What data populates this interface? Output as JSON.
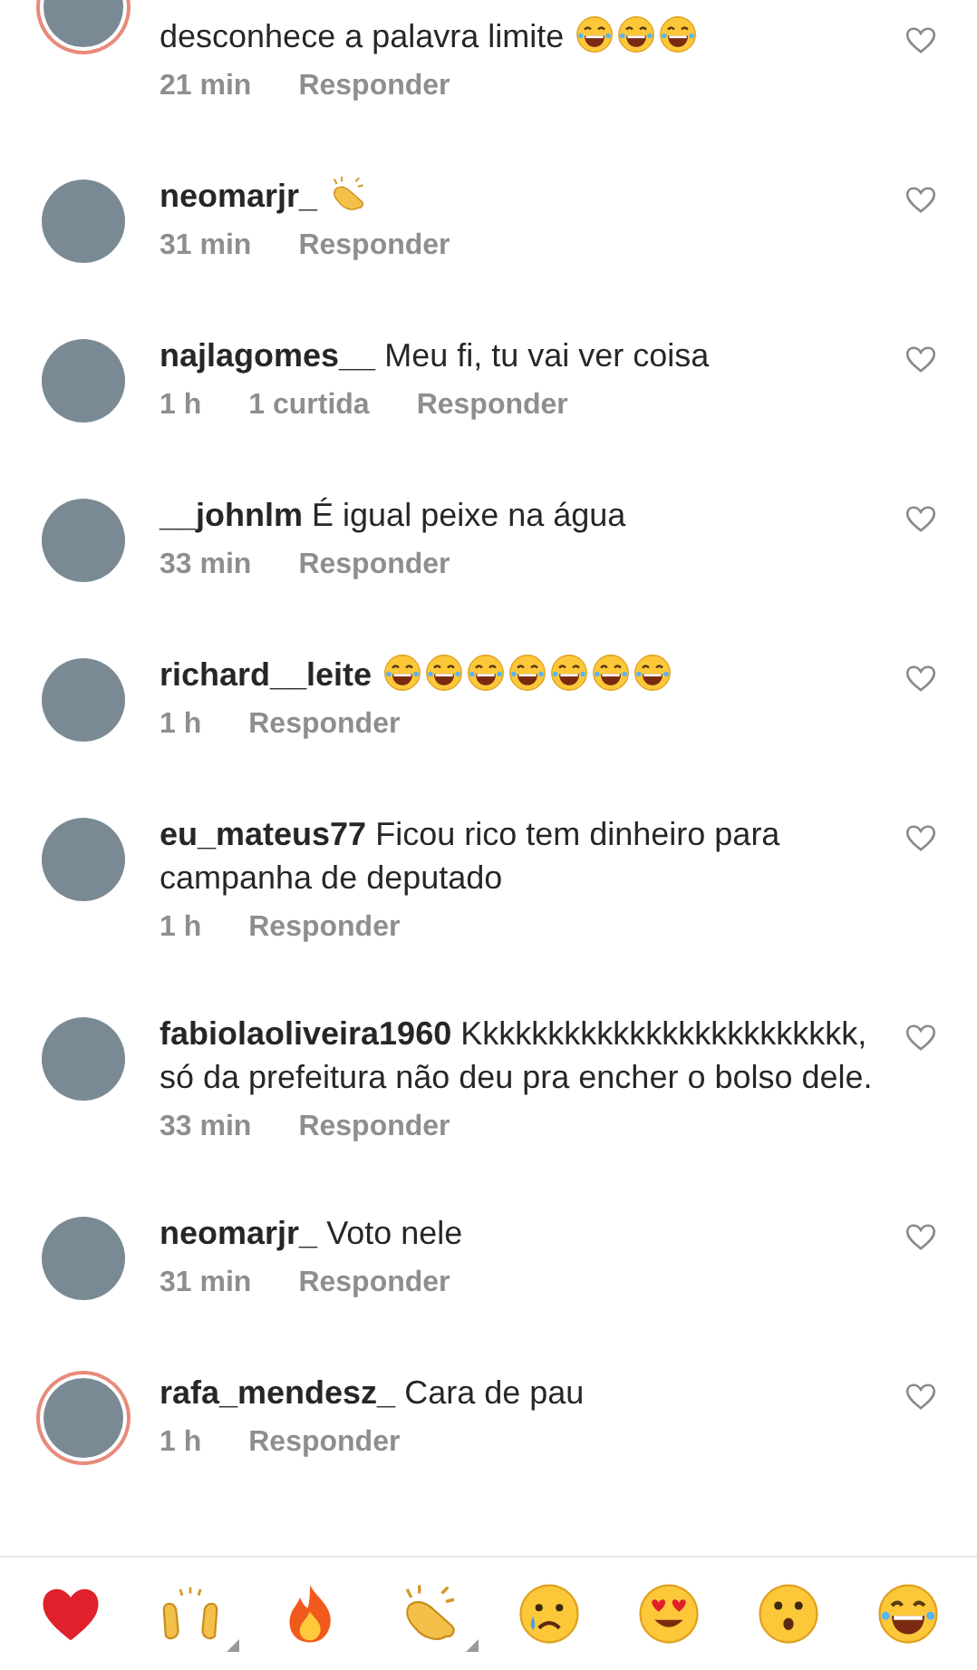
{
  "comments": [
    {
      "text": "desconhece a palavra limite",
      "emojis": [
        {
          "kind": "laughing"
        },
        {
          "kind": "laughing"
        },
        {
          "kind": "laughing"
        }
      ],
      "time": "21 min",
      "reply": "Responder",
      "story": true
    },
    {
      "username": "neomarjr_",
      "emojis": [
        {
          "kind": "clapping"
        }
      ],
      "time": "31 min",
      "reply": "Responder",
      "story": false
    },
    {
      "username": "najlagomes__",
      "text": "Meu fi, tu vai ver coisa",
      "time": "1 h",
      "likes": "1 curtida",
      "reply": "Responder",
      "story": false
    },
    {
      "username": "__johnlm",
      "text": "É igual peixe na água",
      "time": "33 min",
      "reply": "Responder",
      "story": false
    },
    {
      "username": "richard__leite",
      "emojis": [
        {
          "kind": "laughing"
        },
        {
          "kind": "laughing"
        },
        {
          "kind": "laughing"
        },
        {
          "kind": "laughing"
        },
        {
          "kind": "laughing"
        },
        {
          "kind": "laughing"
        },
        {
          "kind": "laughing"
        }
      ],
      "time": "1 h",
      "reply": "Responder",
      "story": false
    },
    {
      "username": "eu_mateus77",
      "text": "Ficou rico tem dinheiro para campanha de deputado",
      "time": "1 h",
      "reply": "Responder",
      "story": false
    },
    {
      "username": "fabiolaoliveira1960",
      "text": "Kkkkkkkkkkkkkkkkkkkkkkkk, só da prefeitura não deu pra encher o bolso dele.",
      "time": "33 min",
      "reply": "Responder",
      "story": false
    },
    {
      "username": "neomarjr_",
      "text": "Voto nele",
      "time": "31 min",
      "reply": "Responder",
      "story": false
    },
    {
      "username": "rafa_mendesz_",
      "text": "Cara de pau",
      "time": "1 h",
      "reply": "Responder",
      "story": true
    }
  ],
  "reactions": [
    {
      "kind": "heart",
      "variants": false
    },
    {
      "kind": "raised-hands",
      "variants": true
    },
    {
      "kind": "fire",
      "variants": false
    },
    {
      "kind": "clapping",
      "variants": true
    },
    {
      "kind": "crying",
      "variants": false
    },
    {
      "kind": "heart-eyes",
      "variants": false
    },
    {
      "kind": "surprised",
      "variants": false
    },
    {
      "kind": "laughing",
      "variants": false
    }
  ]
}
